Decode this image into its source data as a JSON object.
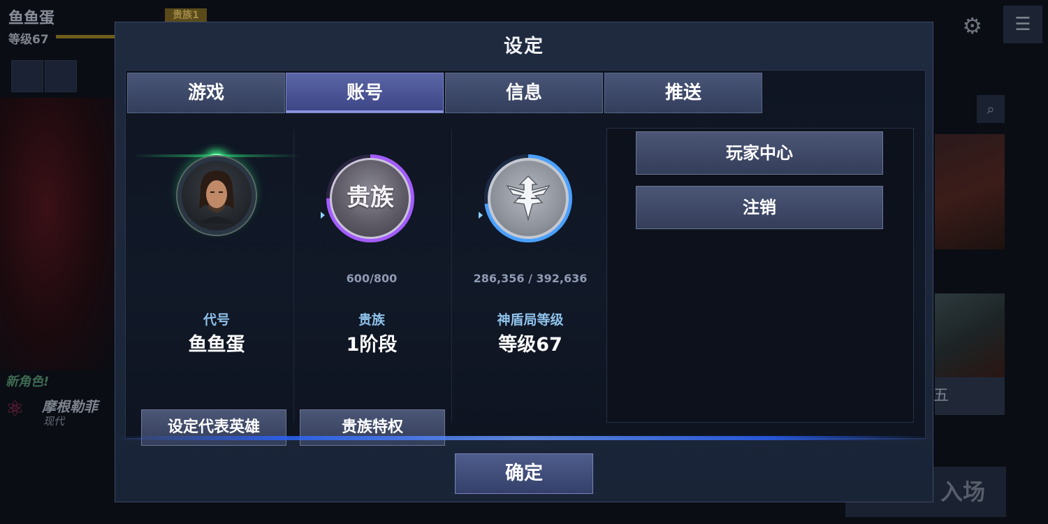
{
  "background": {
    "player_name": "鱼鱼蛋",
    "player_level": "等级67",
    "nobility_badge": "贵族1",
    "new_character_label": "新角色!",
    "new_character_name": "摩根勒菲",
    "new_character_era": "现代",
    "right_card_button": "五",
    "enter_button": "入场"
  },
  "modal": {
    "title": "设定",
    "tabs": [
      "游戏",
      "账号",
      "信息",
      "推送"
    ],
    "active_tab": "账号",
    "profile": {
      "label": "代号",
      "value": "鱼鱼蛋",
      "button": "设定代表英雄"
    },
    "nobility": {
      "emblem_text": "贵族",
      "progress": "600/800",
      "label": "贵族",
      "value": "1阶段",
      "button": "贵族特权"
    },
    "shield": {
      "progress": "286,356 / 392,636",
      "label": "神盾局等级",
      "value": "等级67"
    },
    "actions": {
      "player_center": "玩家中心",
      "logout": "注销"
    },
    "confirm": "确定"
  },
  "colors": {
    "nobility_ring": "#a35cff",
    "shield_ring": "#4aa0ff",
    "avatar_glow": "#3cff90"
  }
}
